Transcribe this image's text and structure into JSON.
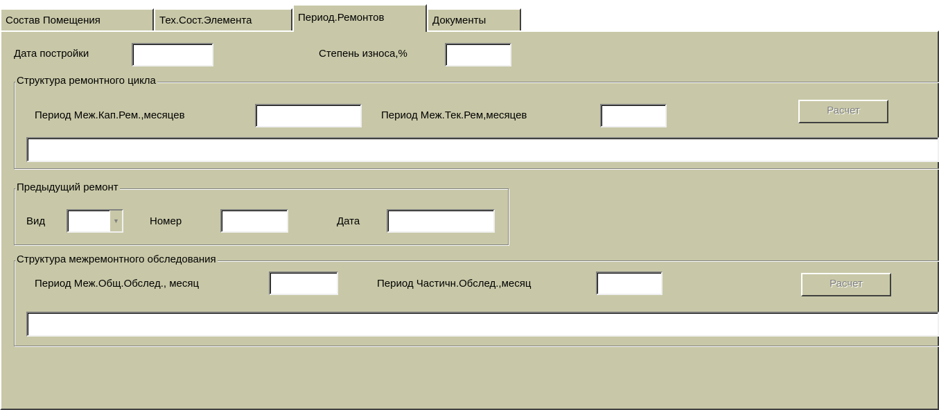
{
  "tabs": [
    {
      "label": "Состав Помещения"
    },
    {
      "label": "Тех.Сост.Элемента"
    },
    {
      "label": "Период.Ремонтов"
    },
    {
      "label": "Документы"
    }
  ],
  "active_tab": "Период.Ремонтов",
  "header": {
    "build_date_label": "Дата постройки",
    "build_date_value": "",
    "wear_label": "Степень износа,%",
    "wear_value": ""
  },
  "repair_cycle": {
    "caption": "Структура ремонтного цикла",
    "capital_period_label": "Период Меж.Кап.Рем.,месяцев",
    "capital_period_value": "",
    "current_period_label": "Период Меж.Тек.Рем,месяцев",
    "current_period_value": "",
    "calc_button": "Расчет",
    "result_value": ""
  },
  "previous_repair": {
    "caption": "Предыдущий ремонт",
    "type_label": "Вид",
    "type_value": "",
    "number_label": "Номер",
    "number_value": "",
    "date_label": "Дата",
    "date_value": ""
  },
  "inspection": {
    "caption": "Структура межремонтного обследования",
    "general_period_label": "Период Меж.Общ.Обслед., месяц",
    "general_period_value": "",
    "partial_period_label": "Период Частичн.Обслед.,месяц",
    "partial_period_value": "",
    "calc_button": "Расчет",
    "result_value": ""
  },
  "colors": {
    "panel": "#c8c8a8",
    "disabled_text": "#808080"
  }
}
